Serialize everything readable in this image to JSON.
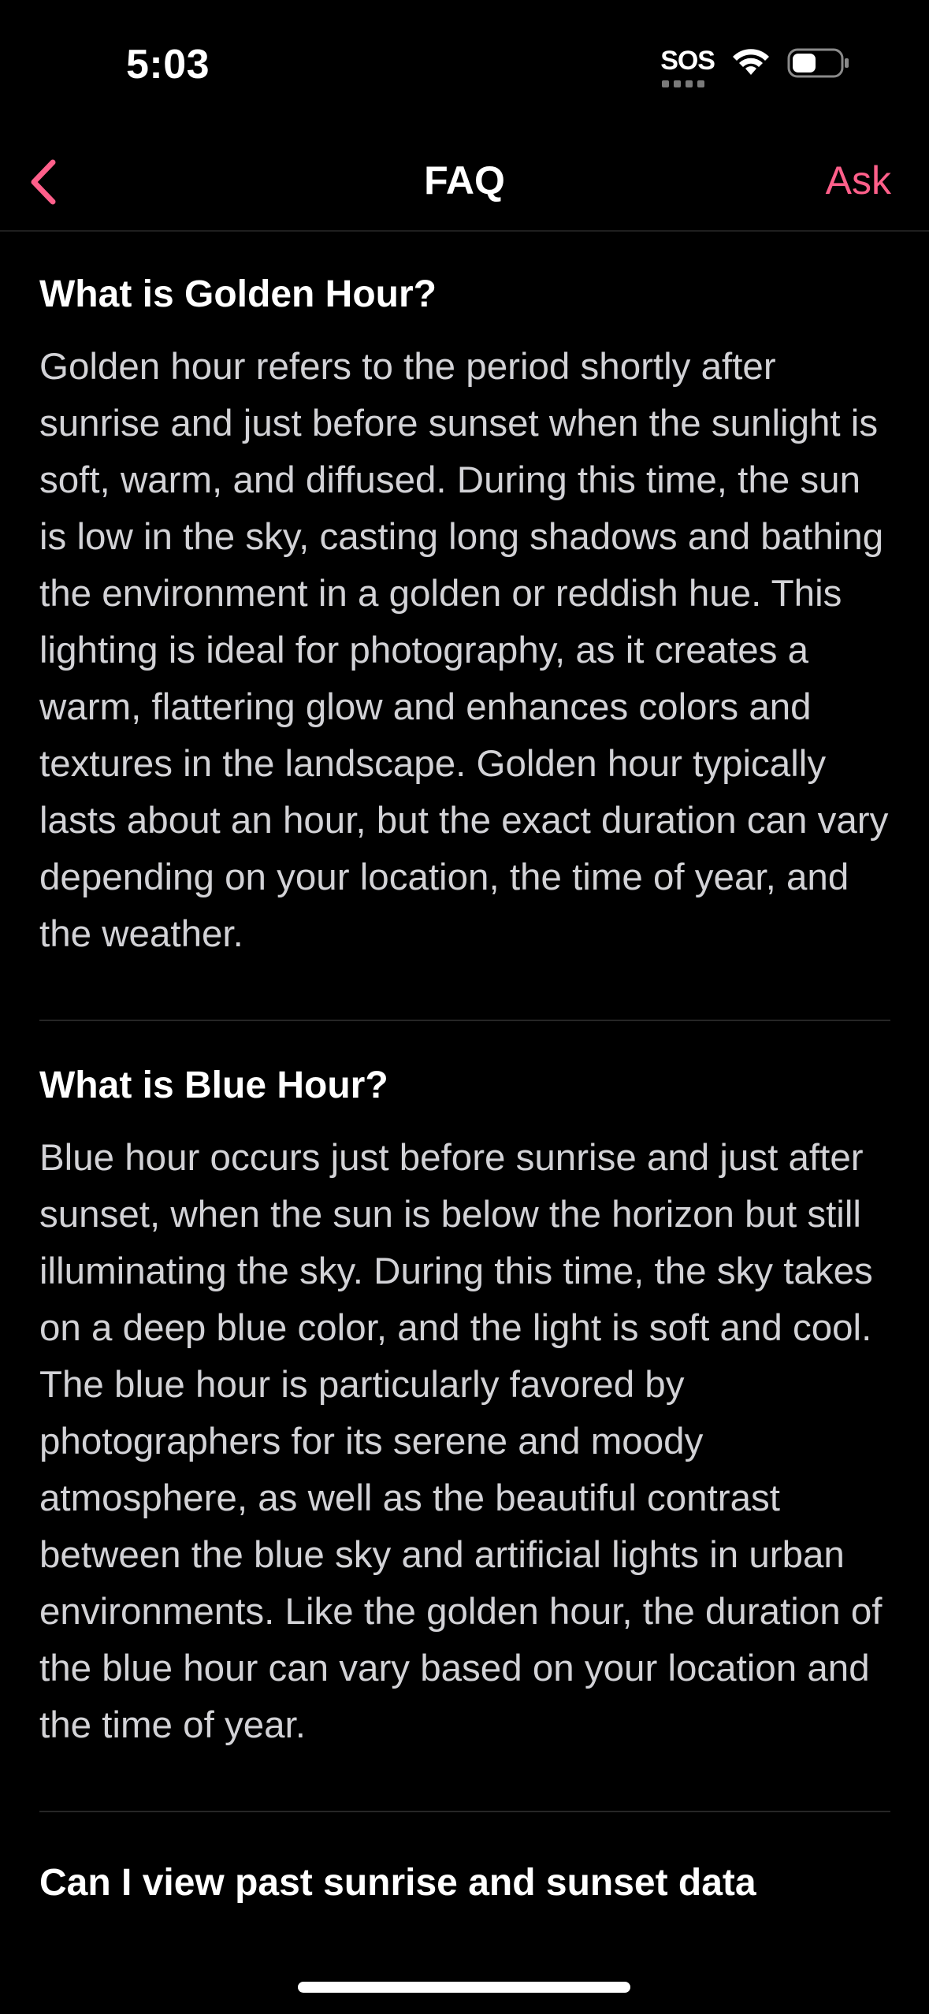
{
  "status_bar": {
    "time": "5:03",
    "sos_label": "SOS",
    "icons": [
      "wifi-icon",
      "battery-icon"
    ]
  },
  "nav": {
    "back_icon": "chevron-left-icon",
    "title": "FAQ",
    "action_label": "Ask"
  },
  "faq": [
    {
      "question": "What is Golden Hour?",
      "answer": "Golden hour refers to the period shortly after sunrise and just before sunset when the sunlight is soft, warm, and diffused. During this time, the sun is low in the sky, casting long shadows and bathing the environment in a golden or reddish hue. This lighting is ideal for photography, as it creates a warm, flattering glow and enhances colors and textures in the landscape. Golden hour typically lasts about an hour, but the exact duration can vary depending on your location, the time of year, and the weather."
    },
    {
      "question": "What is Blue Hour?",
      "answer": "Blue hour occurs just before sunrise and just after sunset, when the sun is below the horizon but still illuminating the sky. During this time, the sky takes on a deep blue color, and the light is soft and cool. The blue hour is particularly favored by photographers for its serene and moody atmosphere, as well as the beautiful contrast between the blue sky and artificial lights in urban environments. Like the golden hour, the duration of the blue hour can vary based on your location and the time of year."
    },
    {
      "question": "Can I view past sunrise and sunset data"
    }
  ],
  "colors": {
    "background": "#000000",
    "accent": "#ff5f8a",
    "body_text": "#d2d2d6",
    "divider": "#262626"
  }
}
